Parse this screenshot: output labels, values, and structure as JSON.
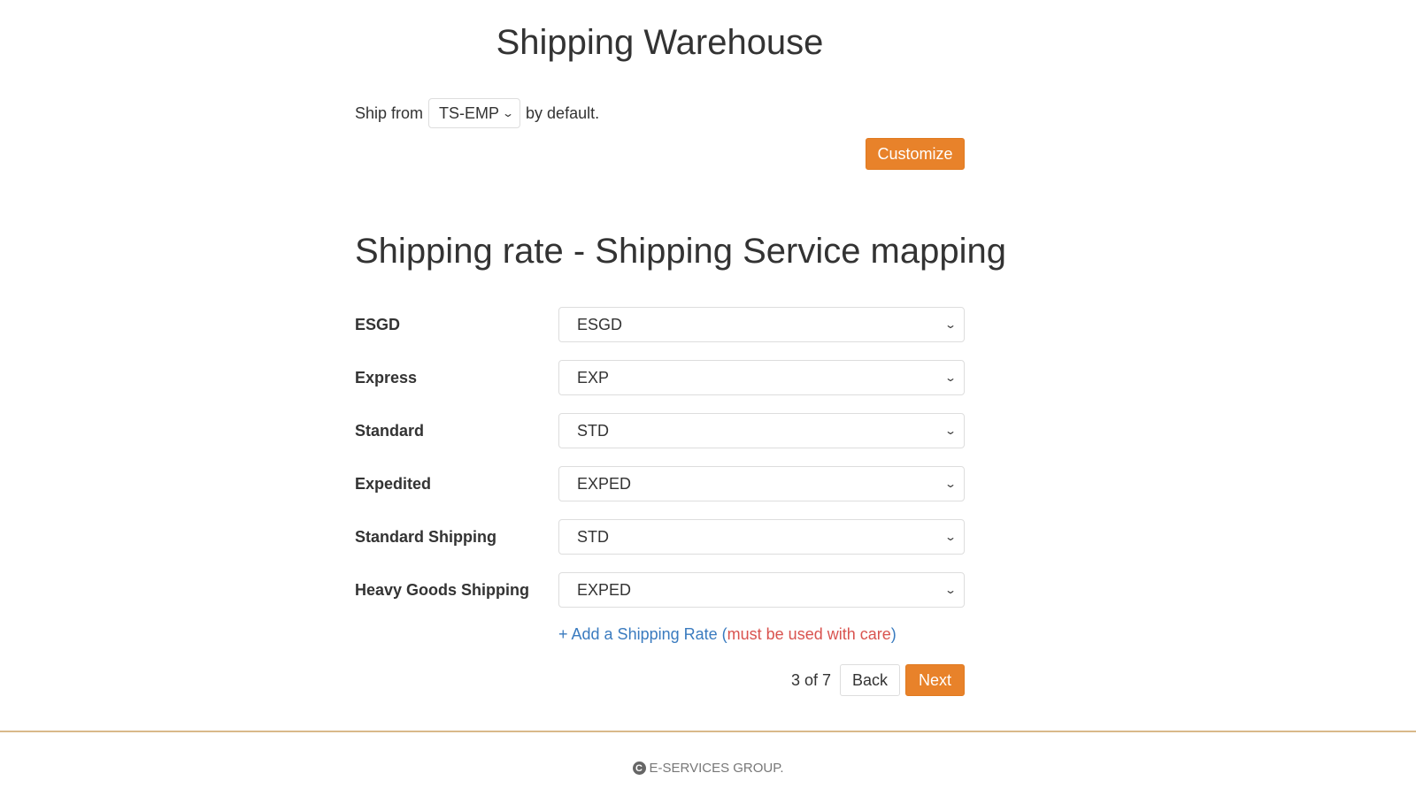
{
  "header": {
    "title": "Shipping Warehouse"
  },
  "ship_from": {
    "prefix": "Ship from",
    "selected": "TS-EMP",
    "suffix": "by default."
  },
  "customize_label": "Customize",
  "mapping": {
    "title": "Shipping rate - Shipping Service mapping",
    "rows": [
      {
        "label": "ESGD",
        "value": "ESGD"
      },
      {
        "label": "Express",
        "value": "EXP"
      },
      {
        "label": "Standard",
        "value": "STD"
      },
      {
        "label": "Expedited",
        "value": "EXPED"
      },
      {
        "label": "Standard Shipping",
        "value": "STD"
      },
      {
        "label": "Heavy Goods Shipping",
        "value": "EXPED"
      }
    ],
    "add_rate_label": "+ Add a Shipping Rate",
    "add_rate_open": "(",
    "add_rate_warning": "must be used with care",
    "add_rate_close": ")"
  },
  "pager": {
    "status": "3 of 7",
    "back_label": "Back",
    "next_label": "Next"
  },
  "footer": {
    "copyright_icon": "copyright-icon",
    "text": "E-SERVICES GROUP."
  },
  "colors": {
    "accent": "#e8822a",
    "link": "#3a7bbf",
    "warning": "#d9534f",
    "footer_rule": "#d9b98a"
  }
}
